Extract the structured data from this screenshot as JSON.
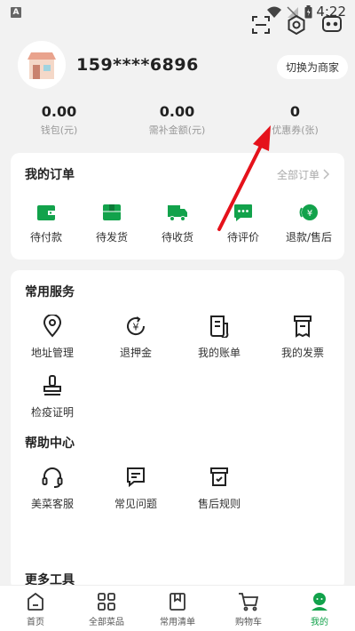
{
  "status": {
    "badge": "A",
    "time": "4:22"
  },
  "profile": {
    "phone": "159****6896",
    "switch_label": "切换为商家"
  },
  "stats": [
    {
      "value": "0.00",
      "label": "钱包(元)"
    },
    {
      "value": "0.00",
      "label": "需补金额(元)"
    },
    {
      "value": "0",
      "label": "优惠券(张)"
    }
  ],
  "orders": {
    "title": "我的订单",
    "all_label": "全部订单",
    "items": [
      {
        "label": "待付款",
        "icon": "wallet-icon"
      },
      {
        "label": "待发货",
        "icon": "box-icon"
      },
      {
        "label": "待收货",
        "icon": "truck-icon"
      },
      {
        "label": "待评价",
        "icon": "chat-icon"
      },
      {
        "label": "退款/售后",
        "icon": "refund-icon"
      }
    ]
  },
  "services": {
    "title": "常用服务",
    "items": [
      {
        "label": "地址管理",
        "icon": "location-pin-icon"
      },
      {
        "label": "退押金",
        "icon": "deposit-refund-icon"
      },
      {
        "label": "我的账单",
        "icon": "bill-icon"
      },
      {
        "label": "我的发票",
        "icon": "invoice-icon"
      },
      {
        "label": "检疫证明",
        "icon": "stamp-icon"
      }
    ]
  },
  "help": {
    "title": "帮助中心",
    "items": [
      {
        "label": "美菜客服",
        "icon": "headset-icon"
      },
      {
        "label": "常见问题",
        "icon": "faq-icon"
      },
      {
        "label": "售后规则",
        "icon": "rules-icon"
      }
    ]
  },
  "more": {
    "title": "更多工具"
  },
  "tabbar": [
    {
      "label": "首页",
      "icon": "home-icon"
    },
    {
      "label": "全部菜品",
      "icon": "grid-icon"
    },
    {
      "label": "常用清单",
      "icon": "bookmark-icon"
    },
    {
      "label": "购物车",
      "icon": "cart-icon"
    },
    {
      "label": "我的",
      "icon": "user-icon",
      "active": true
    }
  ],
  "colors": {
    "accent": "#12a24b",
    "arrow": "#e5121b"
  }
}
